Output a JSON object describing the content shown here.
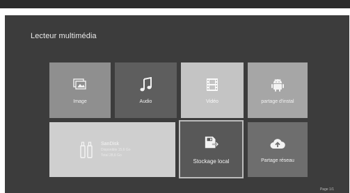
{
  "screen": {
    "title": "Lecteur multimédia",
    "pager": "Page 1/1"
  },
  "tiles": [
    {
      "label": "Image",
      "icon": "image-icon"
    },
    {
      "label": "Audio",
      "icon": "music-note-icon"
    },
    {
      "label": "Vidéo",
      "icon": "film-icon"
    },
    {
      "label": "partage d'instal",
      "icon": "android-icon"
    }
  ],
  "storage": {
    "device_name": "SanDisk",
    "device_line1": "Disponible 15,6 Go",
    "device_line2": "Total 28,6 Go",
    "local_label": "Stockage local",
    "network_label": "Partage réseau"
  },
  "colors": {
    "background": "#3c3c3c",
    "focus_border": "#bdbdbd"
  }
}
